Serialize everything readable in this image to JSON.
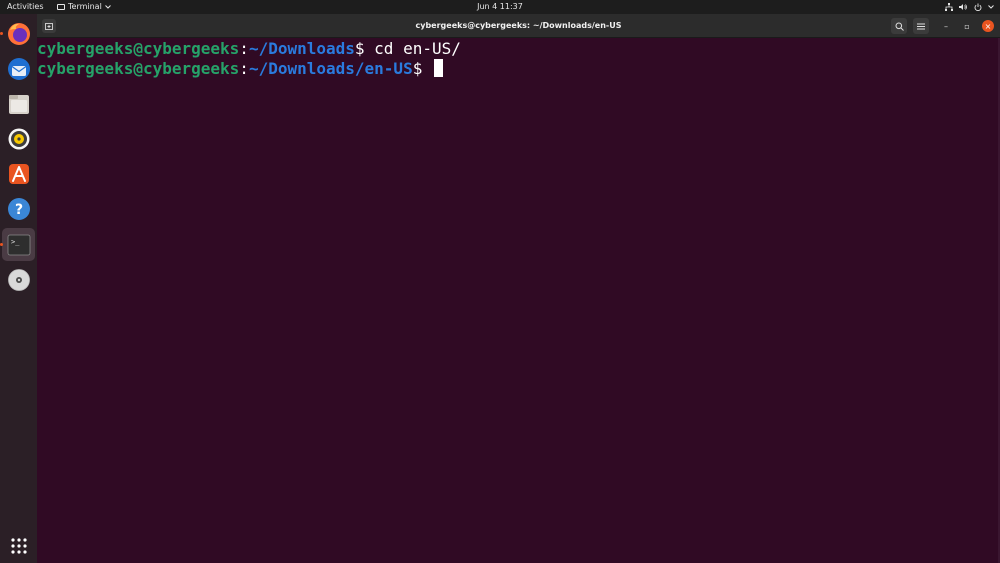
{
  "topbar": {
    "activities": "Activities",
    "app_name": "Terminal",
    "clock": "Jun 4  11:37"
  },
  "dock": {
    "items": [
      {
        "name": "Firefox",
        "icon": "firefox-icon"
      },
      {
        "name": "Thunderbird",
        "icon": "thunderbird-icon"
      },
      {
        "name": "Files",
        "icon": "files-icon"
      },
      {
        "name": "Rhythmbox",
        "icon": "rhythmbox-icon"
      },
      {
        "name": "Ubuntu Software",
        "icon": "software-icon"
      },
      {
        "name": "Help",
        "icon": "help-icon",
        "glyph": "?"
      },
      {
        "name": "Terminal",
        "icon": "terminal-icon",
        "active": true,
        "glyph": ">_"
      },
      {
        "name": "DVD",
        "icon": "disc-icon"
      }
    ],
    "show_apps": "show-apps-icon"
  },
  "window": {
    "title": "cybergeeks@cybergeeks: ~/Downloads/en-US",
    "controls": {
      "minimize": "–",
      "maximize": "▫",
      "close": "×"
    }
  },
  "terminal": {
    "lines": [
      {
        "user": "cybergeeks@cybergeeks",
        "sep": ":",
        "path": "~/Downloads",
        "prompt": "$ ",
        "command": "cd en-US/"
      },
      {
        "user": "cybergeeks@cybergeeks",
        "sep": ":",
        "path": "~/Downloads/en-US",
        "prompt": "$ ",
        "command": ""
      }
    ]
  },
  "colors": {
    "terminal_bg": "#300a24",
    "prompt_user": "#26a269",
    "prompt_path": "#2a7bde",
    "accent": "#e95420"
  }
}
